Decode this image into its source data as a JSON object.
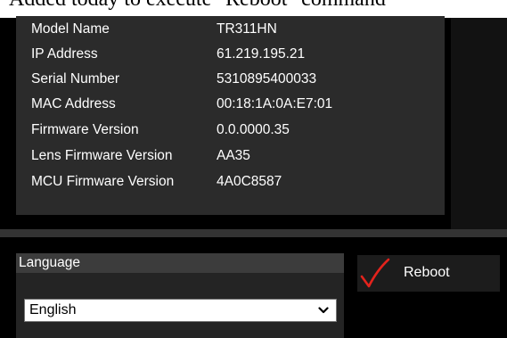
{
  "header_caption": "Added today to execute \"Reboot\" command",
  "device_info": [
    {
      "label": "Model Name",
      "value": "TR311HN"
    },
    {
      "label": "IP Address",
      "value": "61.219.195.21"
    },
    {
      "label": "Serial Number",
      "value": "5310895400033"
    },
    {
      "label": "MAC Address",
      "value": "00:18:1A:0A:E7:01"
    },
    {
      "label": "Firmware Version",
      "value": "0.0.0000.35"
    },
    {
      "label": "Lens Firmware Version",
      "value": "AA35"
    },
    {
      "label": "MCU Firmware Version",
      "value": "4A0C8587"
    }
  ],
  "language": {
    "title": "Language",
    "selected": "English"
  },
  "reboot": {
    "label": "Reboot",
    "icon": "red-check-icon",
    "icon_color": "#e3231c"
  },
  "colors": {
    "background": "#000000",
    "panel": "#2b2b2b",
    "text": "#ffffff"
  }
}
